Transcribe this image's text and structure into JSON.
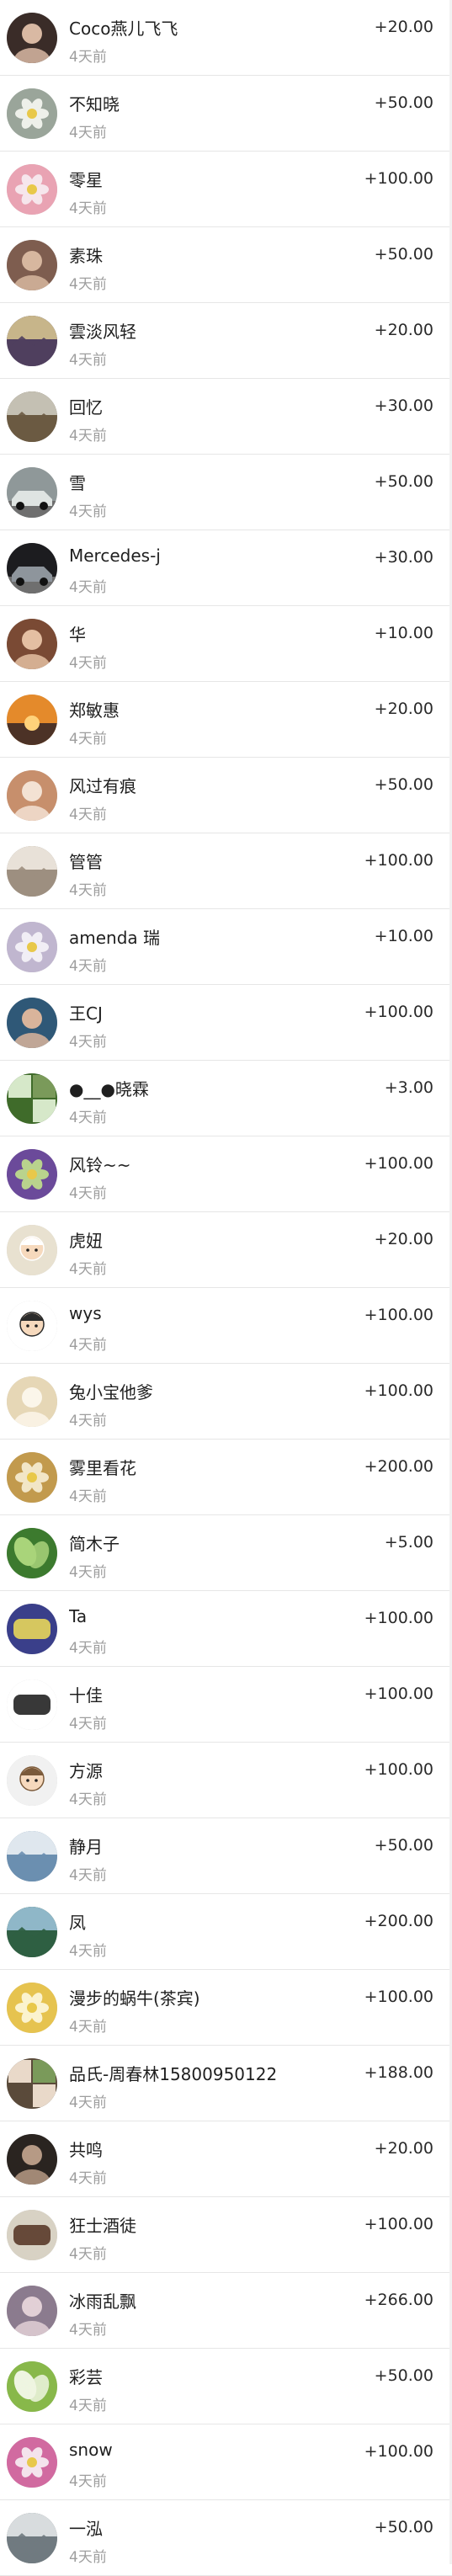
{
  "records": [
    {
      "name": "Coco燕儿飞飞",
      "time": "4天前",
      "amount": "+20.00",
      "avatar": {
        "icon": "user-photo-icon",
        "colors": [
          "#3a2c28",
          "#d9b9a3"
        ]
      }
    },
    {
      "name": "不知晓",
      "time": "4天前",
      "amount": "+50.00",
      "avatar": {
        "icon": "flower-photo-icon",
        "colors": [
          "#9aa59a",
          "#eef0ea"
        ]
      }
    },
    {
      "name": "零星",
      "time": "4天前",
      "amount": "+100.00",
      "avatar": {
        "icon": "flower-photo-icon",
        "colors": [
          "#e9a3b3",
          "#f6e6ec"
        ]
      }
    },
    {
      "name": "素珠",
      "time": "4天前",
      "amount": "+50.00",
      "avatar": {
        "icon": "user-photo-icon",
        "colors": [
          "#7e5d4f",
          "#d7b79f"
        ]
      }
    },
    {
      "name": "雲淡风轻",
      "time": "4天前",
      "amount": "+20.00",
      "avatar": {
        "icon": "landscape-photo-icon",
        "colors": [
          "#4f3f5e",
          "#c7b58a"
        ]
      }
    },
    {
      "name": "回忆",
      "time": "4天前",
      "amount": "+30.00",
      "avatar": {
        "icon": "landscape-photo-icon",
        "colors": [
          "#6b5a42",
          "#c4c0b3"
        ]
      }
    },
    {
      "name": "雪",
      "time": "4天前",
      "amount": "+50.00",
      "avatar": {
        "icon": "car-photo-icon",
        "colors": [
          "#8f9899",
          "#dfe4e2"
        ]
      }
    },
    {
      "name": "Mercedes-j",
      "time": "4天前",
      "amount": "+30.00",
      "avatar": {
        "icon": "car-photo-icon",
        "colors": [
          "#1c1c1f",
          "#8e959c"
        ]
      }
    },
    {
      "name": "华",
      "time": "4天前",
      "amount": "+10.00",
      "avatar": {
        "icon": "user-photo-icon",
        "colors": [
          "#7a4a34",
          "#e4bfa2"
        ]
      }
    },
    {
      "name": "郑敏惠",
      "time": "4天前",
      "amount": "+20.00",
      "avatar": {
        "icon": "sunset-photo-icon",
        "colors": [
          "#e48a2b",
          "#4c3226"
        ]
      }
    },
    {
      "name": "风过有痕",
      "time": "4天前",
      "amount": "+50.00",
      "avatar": {
        "icon": "baby-photo-icon",
        "colors": [
          "#c78f6c",
          "#f3e2d3"
        ]
      }
    },
    {
      "name": "管管",
      "time": "4天前",
      "amount": "+100.00",
      "avatar": {
        "icon": "landscape-photo-icon",
        "colors": [
          "#9d8f80",
          "#e8e1d8"
        ]
      }
    },
    {
      "name": "amenda 瑞",
      "time": "4天前",
      "amount": "+10.00",
      "avatar": {
        "icon": "flower-photo-icon",
        "colors": [
          "#c0b6cf",
          "#f1eef5"
        ]
      }
    },
    {
      "name": "王CJ",
      "time": "4天前",
      "amount": "+100.00",
      "avatar": {
        "icon": "user-photo-icon",
        "colors": [
          "#2f5877",
          "#d9b49b"
        ]
      }
    },
    {
      "name": "●__●晓霖",
      "time": "4天前",
      "amount": "+3.00",
      "avatar": {
        "icon": "collage-photo-icon",
        "colors": [
          "#3f6b2a",
          "#d6e8c9"
        ]
      }
    },
    {
      "name": "风铃~~",
      "time": "4天前",
      "amount": "+100.00",
      "avatar": {
        "icon": "flower-photo-icon",
        "colors": [
          "#6b4a9a",
          "#b9d38d"
        ]
      }
    },
    {
      "name": "虎妞",
      "time": "4天前",
      "amount": "+20.00",
      "avatar": {
        "icon": "cartoon-avatar-icon",
        "colors": [
          "#e8e1d0",
          "#ffffff"
        ]
      }
    },
    {
      "name": "wys",
      "time": "4天前",
      "amount": "+100.00",
      "avatar": {
        "icon": "cartoon-avatar-icon",
        "colors": [
          "#ffffff",
          "#2b2b2b"
        ]
      }
    },
    {
      "name": "兔小宝他爹",
      "time": "4天前",
      "amount": "+100.00",
      "avatar": {
        "icon": "baby-photo-icon",
        "colors": [
          "#e6d7b6",
          "#fbf6ea"
        ]
      }
    },
    {
      "name": "雾里看花",
      "time": "4天前",
      "amount": "+200.00",
      "avatar": {
        "icon": "flower-photo-icon",
        "colors": [
          "#c29a4d",
          "#f2e6c7"
        ]
      }
    },
    {
      "name": "简木子",
      "time": "4天前",
      "amount": "+5.00",
      "avatar": {
        "icon": "plant-photo-icon",
        "colors": [
          "#3c7a2e",
          "#a9d47a"
        ]
      }
    },
    {
      "name": "Ta",
      "time": "4天前",
      "amount": "+100.00",
      "avatar": {
        "icon": "text-logo-icon",
        "colors": [
          "#3a3f8a",
          "#e8d65a"
        ]
      }
    },
    {
      "name": "十佳",
      "time": "4天前",
      "amount": "+100.00",
      "avatar": {
        "icon": "text-logo-icon",
        "colors": [
          "#ffffff",
          "#222222"
        ]
      }
    },
    {
      "name": "方源",
      "time": "4天前",
      "amount": "+100.00",
      "avatar": {
        "icon": "cartoon-avatar-icon",
        "colors": [
          "#f1f1f1",
          "#7b5a3a"
        ]
      }
    },
    {
      "name": "静月",
      "time": "4天前",
      "amount": "+50.00",
      "avatar": {
        "icon": "landscape-photo-icon",
        "colors": [
          "#6c8fb0",
          "#dfe7ee"
        ]
      }
    },
    {
      "name": "凤",
      "time": "4天前",
      "amount": "+200.00",
      "avatar": {
        "icon": "landscape-photo-icon",
        "colors": [
          "#2f5f43",
          "#8fb7c8"
        ]
      }
    },
    {
      "name": "漫步的蜗牛(茶宾)",
      "time": "4天前",
      "amount": "+100.00",
      "avatar": {
        "icon": "flower-photo-icon",
        "colors": [
          "#e6c34f",
          "#fbf3cf"
        ]
      }
    },
    {
      "name": "品氏-周春林15800950122",
      "time": "4天前",
      "amount": "+188.00",
      "avatar": {
        "icon": "collage-photo-icon",
        "colors": [
          "#5a4a3a",
          "#e9d9c9"
        ]
      }
    },
    {
      "name": "共鸣",
      "time": "4天前",
      "amount": "+20.00",
      "avatar": {
        "icon": "user-photo-icon",
        "colors": [
          "#2a2420",
          "#b69a85"
        ]
      }
    },
    {
      "name": "狂士酒徒",
      "time": "4天前",
      "amount": "+100.00",
      "avatar": {
        "icon": "text-logo-icon",
        "colors": [
          "#d8d2c4",
          "#5a3a2a"
        ]
      }
    },
    {
      "name": "冰雨乱飘",
      "time": "4天前",
      "amount": "+266.00",
      "avatar": {
        "icon": "user-photo-icon",
        "colors": [
          "#8b7b8e",
          "#e2d0d6"
        ]
      }
    },
    {
      "name": "彩芸",
      "time": "4天前",
      "amount": "+50.00",
      "avatar": {
        "icon": "plant-photo-icon",
        "colors": [
          "#88b84a",
          "#eef5e1"
        ]
      }
    },
    {
      "name": "snow",
      "time": "4天前",
      "amount": "+100.00",
      "avatar": {
        "icon": "flower-photo-icon",
        "colors": [
          "#d16aa0",
          "#f4e3ec"
        ]
      }
    },
    {
      "name": "一泓",
      "time": "4天前",
      "amount": "+50.00",
      "avatar": {
        "icon": "landscape-photo-icon",
        "colors": [
          "#707a80",
          "#d8dcde"
        ]
      }
    }
  ]
}
